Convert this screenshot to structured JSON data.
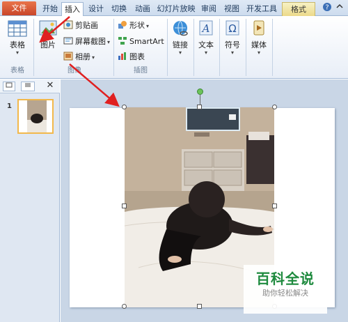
{
  "tabs": {
    "file": "文件",
    "home": "开始",
    "insert": "插入",
    "design": "设计",
    "transitions": "切换",
    "animations": "动画",
    "slideshow": "幻灯片放映",
    "review": "审阅",
    "view": "视图",
    "developer": "开发工具",
    "format": "格式"
  },
  "ribbon": {
    "table": "表格",
    "picture": "图片",
    "clipart": "剪贴画",
    "screenshot": "屏幕截图",
    "album": "相册",
    "shapes": "形状",
    "smartart": "SmartArt",
    "chart": "图表",
    "hyperlink": "链接",
    "text": "文本",
    "symbol": "符号",
    "media": "媒体",
    "group_tables": "表格",
    "group_images": "图像",
    "group_illustrations": "插图",
    "dropdown": "▾"
  },
  "panel": {
    "slide_number": "1"
  },
  "watermark": {
    "title": "百科全说",
    "subtitle": "助你轻松解决"
  },
  "colors": {
    "file_tab": "#c9462a",
    "ribbon_bg": "#e8eef7",
    "workspace": "#c9d6e6",
    "arrow": "#e02020",
    "watermark_green": "#1e8a3e"
  },
  "icons": [
    "help-icon",
    "minimize-ribbon-icon",
    "table-icon",
    "picture-icon",
    "clipart-icon",
    "screenshot-icon",
    "album-icon",
    "shapes-icon",
    "smartart-icon",
    "chart-icon",
    "hyperlink-icon",
    "text-icon",
    "symbol-icon",
    "media-icon",
    "close-icon"
  ]
}
